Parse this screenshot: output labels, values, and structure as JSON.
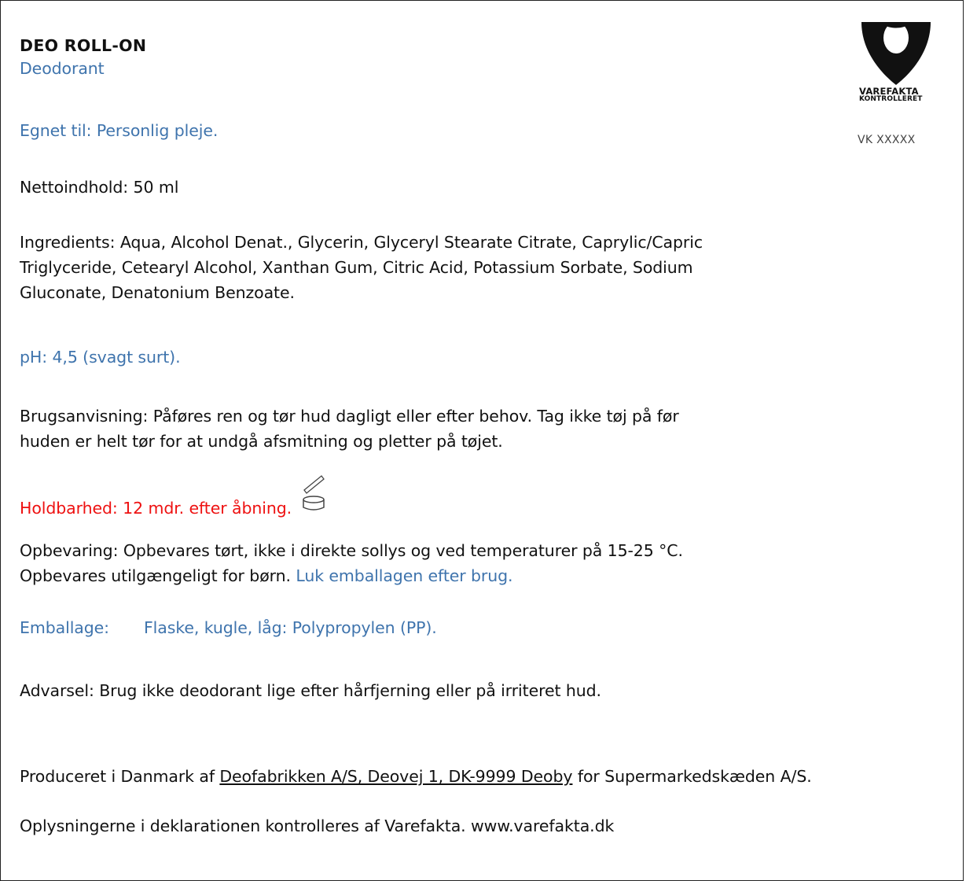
{
  "product": {
    "name": "DEO ROLL-ON",
    "type": "Deodorant"
  },
  "logo": {
    "brand": "VAREFAKTA",
    "sub": "KONTROLLERET",
    "code": "VK XXXXX"
  },
  "suitable": {
    "label": "Egnet til:",
    "value": "Personlig pleje."
  },
  "net": {
    "label": "Nettoindhold:",
    "value": "50 ml"
  },
  "ingredients": {
    "label": "Ingredients:",
    "line1": "Aqua, Alcohol Denat., Glycerin, Glyceryl Stearate Citrate, Caprylic/Capric",
    "line2": "Triglyceride, Cetearyl Alcohol, Xanthan Gum, Citric Acid, Potassium Sorbate, Sodium",
    "line3": "Gluconate, Denatonium Benzoate."
  },
  "ph": {
    "label": "pH:",
    "value": "4,5 (svagt surt)."
  },
  "usage": {
    "label": "Brugsanvisning:",
    "line1": "Påføres ren og tør hud dagligt eller efter behov. Tag ikke tøj på før",
    "line2": "huden er helt tør for at undgå afsmitning og pletter på tøjet."
  },
  "shelf_life": {
    "label": "Holdbarhed:",
    "value": "12 mdr. efter åbning.",
    "icon": "pao-open-jar-icon"
  },
  "storage": {
    "label": "Opbevaring:",
    "line1": "Opbevares tørt, ikke i direkte sollys og ved temperaturer på 15-25 °C.",
    "line2_black": "Opbevares utilgængeligt for børn.",
    "line2_blue": "Luk emballagen efter brug."
  },
  "packaging": {
    "label": "Emballage:",
    "value": "Flaske, kugle, låg: Polypropylen (PP)."
  },
  "warning": {
    "label": "Advarsel",
    "value": ": Brug ikke deodorant lige efter hårfjerning eller på irriteret hud."
  },
  "producer": {
    "prefix": "Produceret i Danmark af",
    "link": "Deofabrikken A/S, Deovej 1, DK-9999 Deoby",
    "suffix": "for Supermarkedskæden A/S."
  },
  "control": {
    "text": "Oplysningerne i deklarationen kontrolleres af Varefakta. www.varefakta.dk"
  },
  "colors": {
    "accent_blue": "#3f74ad",
    "warning_red": "#ee1111",
    "text": "#111111"
  }
}
